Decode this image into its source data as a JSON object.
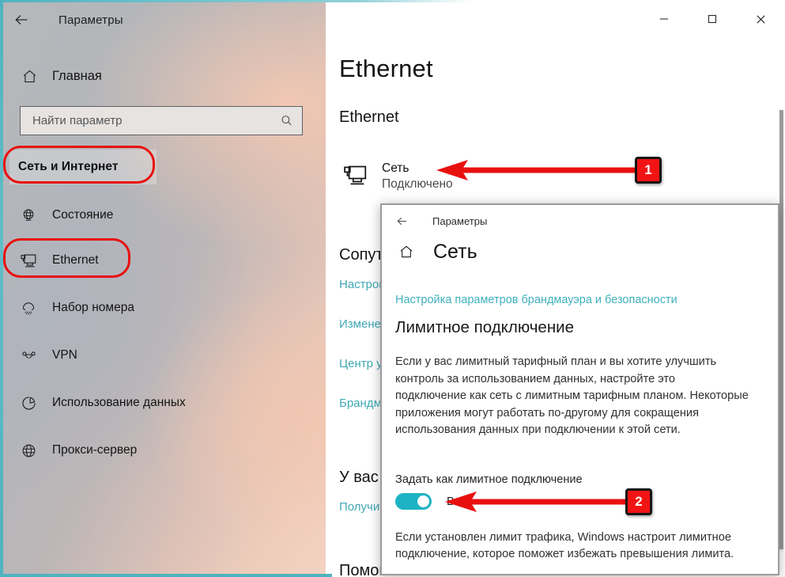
{
  "window": {
    "app_title": "Параметры",
    "back_icon": "back-arrow-icon",
    "minimize_label": "—",
    "maximize_label": "□",
    "close_label": "✕"
  },
  "sidebar": {
    "home": {
      "label": "Главная",
      "icon": "home-icon"
    },
    "search": {
      "placeholder": "Найти параметр",
      "icon": "search-icon"
    },
    "category": {
      "label": "Сеть и Интернет",
      "highlighted": true
    },
    "items": [
      {
        "label": "Состояние",
        "icon": "globe-status-icon"
      },
      {
        "label": "Ethernet",
        "icon": "ethernet-icon",
        "highlighted": true
      },
      {
        "label": "Набор номера",
        "icon": "dialup-icon"
      },
      {
        "label": "VPN",
        "icon": "vpn-icon"
      },
      {
        "label": "Использование данных",
        "icon": "data-usage-pie-icon"
      },
      {
        "label": "Прокси-сервер",
        "icon": "proxy-globe-icon"
      }
    ]
  },
  "main": {
    "page_title": "Ethernet",
    "section_title": "Ethernet",
    "network": {
      "name": "Сеть",
      "status": "Подключено",
      "icon": "ethernet-network-icon"
    },
    "occluded_column": {
      "heading": "Сопутствующие параметры",
      "links": [
        "Настройка параметров адаптера",
        "Изменение расширенных параметров общего доступа",
        "Центр управления сетями и общим доступом",
        "Брандмауэр Windows"
      ],
      "heading2": "У вас есть вопрос?",
      "link2": "Получить справку",
      "heading3": "Помогите сделать Windows лучше"
    }
  },
  "popup": {
    "app_title": "Параметры",
    "back_icon": "back-arrow-icon",
    "home_icon": "home-icon",
    "title": "Сеть",
    "link": "Настройка параметров брандмауэра и безопасности",
    "heading": "Лимитное подключение",
    "body": "Если у вас лимитный тарифный план и вы хотите улучшить контроль за использованием данных, настройте это подключение как сеть с лимитным тарифным планом. Некоторые приложения могут работать по-другому для сокращения использования данных при подключении к этой сети.",
    "toggle_label": "Задать как лимитное подключение",
    "toggle_state": "Вкл.",
    "toggle_on": true,
    "footer": "Если установлен лимит трафика, Windows настроит лимитное подключение, которое поможет избежать превышения лимита."
  },
  "annotations": {
    "badge_1": "1",
    "badge_2": "2"
  },
  "colors": {
    "accent_teal": "#1db3c4",
    "link_teal": "#3fb0bd",
    "annotation_red": "#e8100f",
    "badge_red": "#f21414",
    "window_border_teal": "#4fb3bf"
  }
}
